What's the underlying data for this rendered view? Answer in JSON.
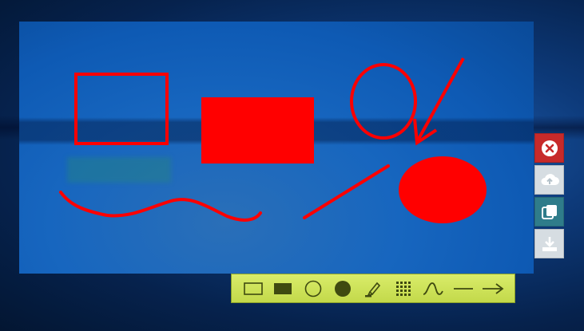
{
  "sidebar": {
    "buttons": [
      {
        "name": "close",
        "icon": "close-circle-icon"
      },
      {
        "name": "upload",
        "icon": "cloud-upload-icon"
      },
      {
        "name": "copy",
        "icon": "copy-icon"
      },
      {
        "name": "save",
        "icon": "download-icon"
      }
    ]
  },
  "toolbar": {
    "tools": [
      {
        "name": "rectangle",
        "icon": "rectangle-outline-icon"
      },
      {
        "name": "filled-rectangle",
        "icon": "rectangle-filled-icon"
      },
      {
        "name": "ellipse",
        "icon": "ellipse-outline-icon"
      },
      {
        "name": "filled-ellipse",
        "icon": "ellipse-filled-icon"
      },
      {
        "name": "marker",
        "icon": "marker-pen-icon"
      },
      {
        "name": "pixelate",
        "icon": "pixelate-grid-icon"
      },
      {
        "name": "freehand",
        "icon": "freehand-curve-icon"
      },
      {
        "name": "line",
        "icon": "line-icon"
      },
      {
        "name": "arrow",
        "icon": "arrow-right-icon"
      }
    ]
  },
  "colors": {
    "annotation": "#ff0000",
    "toolbar_bg": "#cfe35a",
    "toolbar_icon": "#3f4a10",
    "close_bg": "#c72a2a",
    "copy_bg": "#2f7c8a"
  }
}
